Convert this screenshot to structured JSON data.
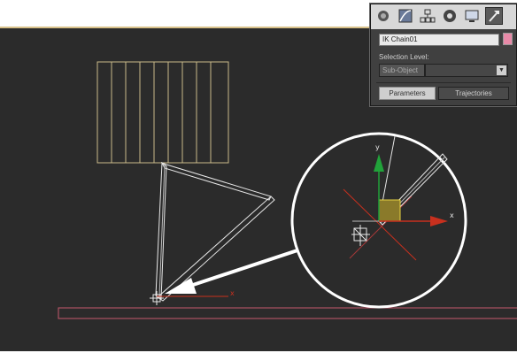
{
  "command_panel": {
    "tabs": [
      {
        "name": "create-tab",
        "icon": "sphere-icon",
        "active": false
      },
      {
        "name": "modify-tab",
        "icon": "modify-curve-icon",
        "active": false
      },
      {
        "name": "hierarchy-tab",
        "icon": "hierarchy-icon",
        "active": false
      },
      {
        "name": "motion-tab",
        "icon": "motion-icon",
        "active": false
      },
      {
        "name": "display-tab",
        "icon": "monitor-icon",
        "active": false
      },
      {
        "name": "utilities-tab",
        "icon": "hammer-icon",
        "active": true
      }
    ],
    "object_name": "IK Chain01",
    "object_color": "#e88aa8",
    "selection_level_label": "Selection Level:",
    "subobject_label": "Sub-Object",
    "subobject_value": "",
    "parameters_tab": "Parameters",
    "trajectories_tab": "Trajectories"
  },
  "viewport": {
    "background": "#2b2b2b",
    "axis_labels": {
      "x": "x",
      "y": "y"
    }
  },
  "colors": {
    "wire_yellow": "#c9b98a",
    "wire_white": "#e8e8e8",
    "ground_pink": "#c4586e",
    "axis_red": "#c8301e",
    "axis_green": "#21a33a",
    "axis_yellow": "#e6d040",
    "callout_white": "#ffffff"
  }
}
